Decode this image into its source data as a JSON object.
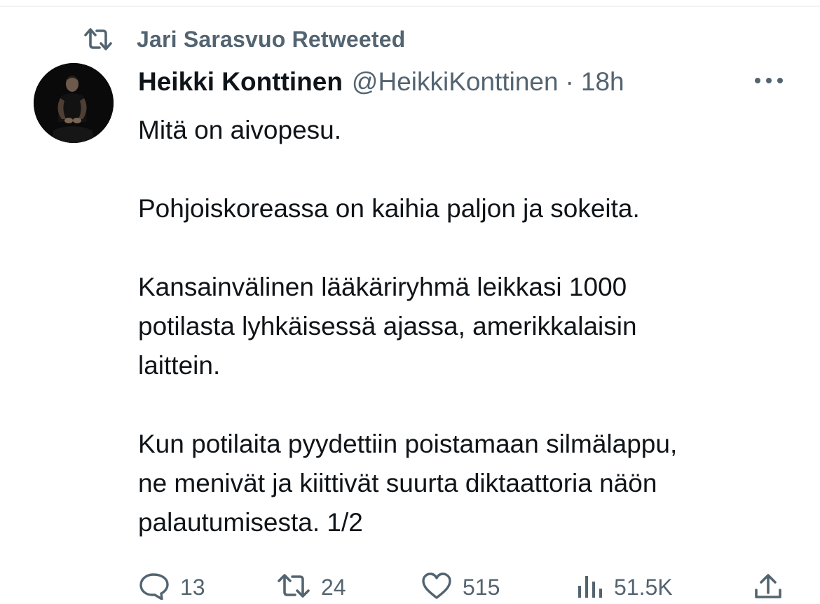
{
  "retweet_banner": {
    "icon": "retweet-icon",
    "text": "Jari Sarasvuo Retweeted"
  },
  "tweet": {
    "author": {
      "display_name": "Heikki Konttinen",
      "handle": "@HeikkiKonttinen",
      "avatar": "avatar-photo"
    },
    "separator": "·",
    "time": "18h",
    "more_icon": "more-horizontal-icon",
    "paragraphs": [
      [
        "Mitä on aivopesu."
      ],
      [
        "Pohjoiskoreassa on kaihia paljon ja sokeita."
      ],
      [
        "Kansainvälinen lääkäriryhmä leikkasi 1000",
        "potilasta lyhkäisessä ajassa, amerikkalaisin",
        "laittein."
      ],
      [
        "Kun potilaita pyydettiin poistamaan silmälappu,",
        "ne menivät ja kiittivät suurta diktaattoria näön",
        "palautumisesta. 1/2"
      ]
    ],
    "actions": {
      "reply": {
        "icon": "reply-icon",
        "count": "13"
      },
      "retweet": {
        "icon": "retweet-icon",
        "count": "24"
      },
      "like": {
        "icon": "heart-icon",
        "count": "515"
      },
      "views": {
        "icon": "views-icon",
        "count": "51.5K"
      },
      "share": {
        "icon": "share-icon"
      }
    }
  },
  "colors": {
    "text_primary": "#0f1419",
    "text_secondary": "#536471",
    "divider": "#eff3f4"
  }
}
